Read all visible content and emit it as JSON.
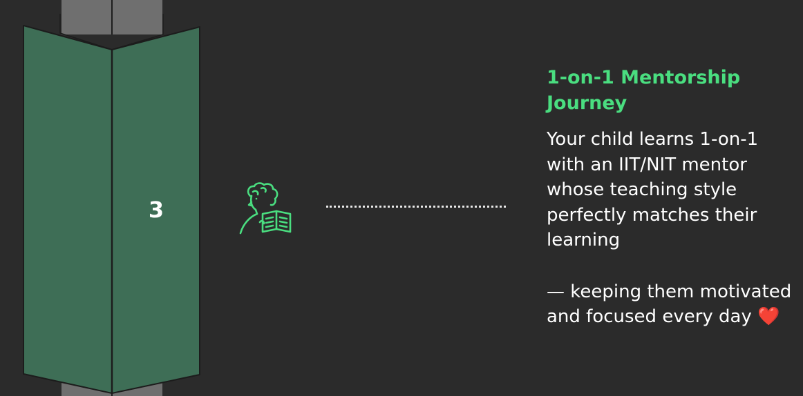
{
  "step": {
    "number": "3"
  },
  "icon": {
    "name": "student-reading-book-icon"
  },
  "content": {
    "title": "1-on-1 Mentorship Journey",
    "paragraph1": "Your child learns 1-on-1 with an IIT/NIT mentor whose teaching style perfectly matches their learning",
    "paragraph2": "— keeping them motivated and focused every day",
    "heart": "❤️"
  },
  "colors": {
    "background": "#2b2b2b",
    "pillar_green": "#3e6e56",
    "pole_gray": "#6f6f6f",
    "accent_green": "#4ade80",
    "text_white": "#ffffff",
    "heart_red": "#e5262f"
  }
}
